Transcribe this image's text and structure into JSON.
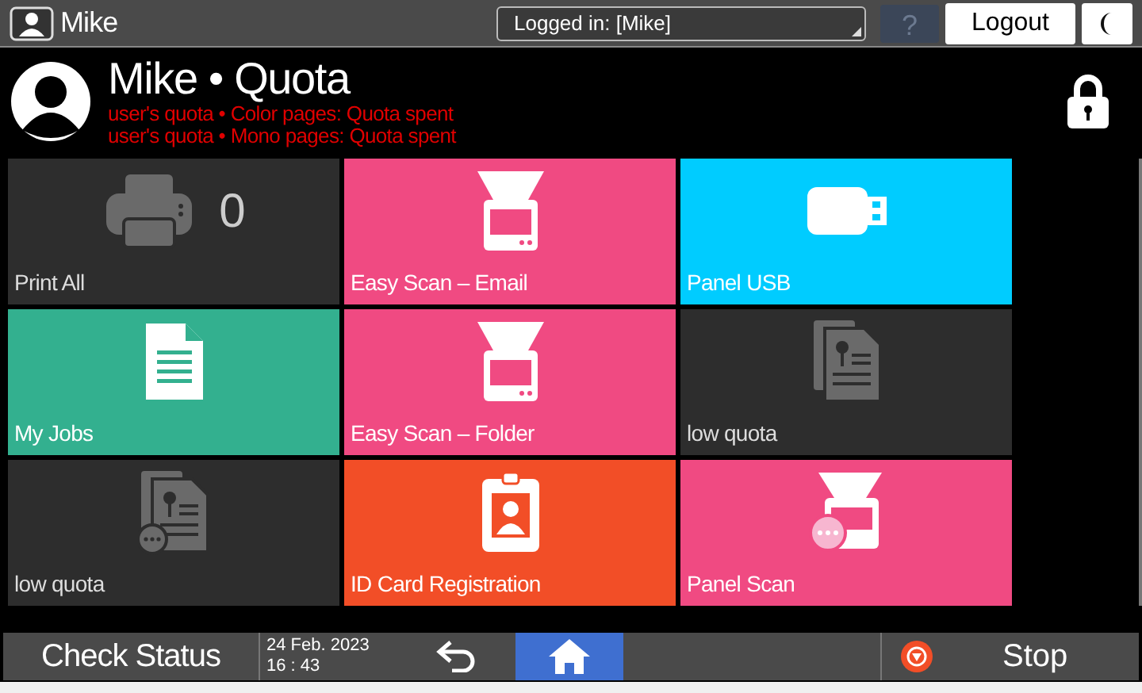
{
  "top_bar": {
    "user": "Mike",
    "login_status": "Logged in: [Mike]",
    "help": {
      "label": "?",
      "disabled": true
    },
    "logout": "Logout"
  },
  "header": {
    "title": "Mike • Quota",
    "messages": [
      "user's quota • Color pages: Quota spent",
      "user's quota • Mono pages: Quota spent"
    ],
    "locked": true
  },
  "tiles": [
    {
      "label": "Print All",
      "kind": "printer",
      "color": "#2d2d2d",
      "count": "0"
    },
    {
      "label": "Easy Scan – Email",
      "kind": "scanner",
      "color": "#f04a82"
    },
    {
      "label": "Panel USB",
      "kind": "usb",
      "color": "#00ccff"
    },
    {
      "label": "My Jobs",
      "kind": "document",
      "color": "#33b08f"
    },
    {
      "label": "Easy Scan – Folder",
      "kind": "scanner",
      "color": "#f04a82"
    },
    {
      "label": "low quota",
      "kind": "documents",
      "color": "#2d2d2d"
    },
    {
      "label": "low quota",
      "kind": "documents_more",
      "color": "#2d2d2d"
    },
    {
      "label": "ID Card Registration",
      "kind": "id_card",
      "color": "#f24e27"
    },
    {
      "label": "Panel Scan",
      "kind": "scanner_more",
      "color": "#f04a82"
    }
  ],
  "bottom_bar": {
    "check_status": "Check Status",
    "date": "24 Feb. 2023",
    "time": "16 : 43",
    "nav": [
      {
        "kind": "back",
        "selected": false
      },
      {
        "kind": "home",
        "selected": true
      }
    ],
    "stop": "Stop"
  }
}
